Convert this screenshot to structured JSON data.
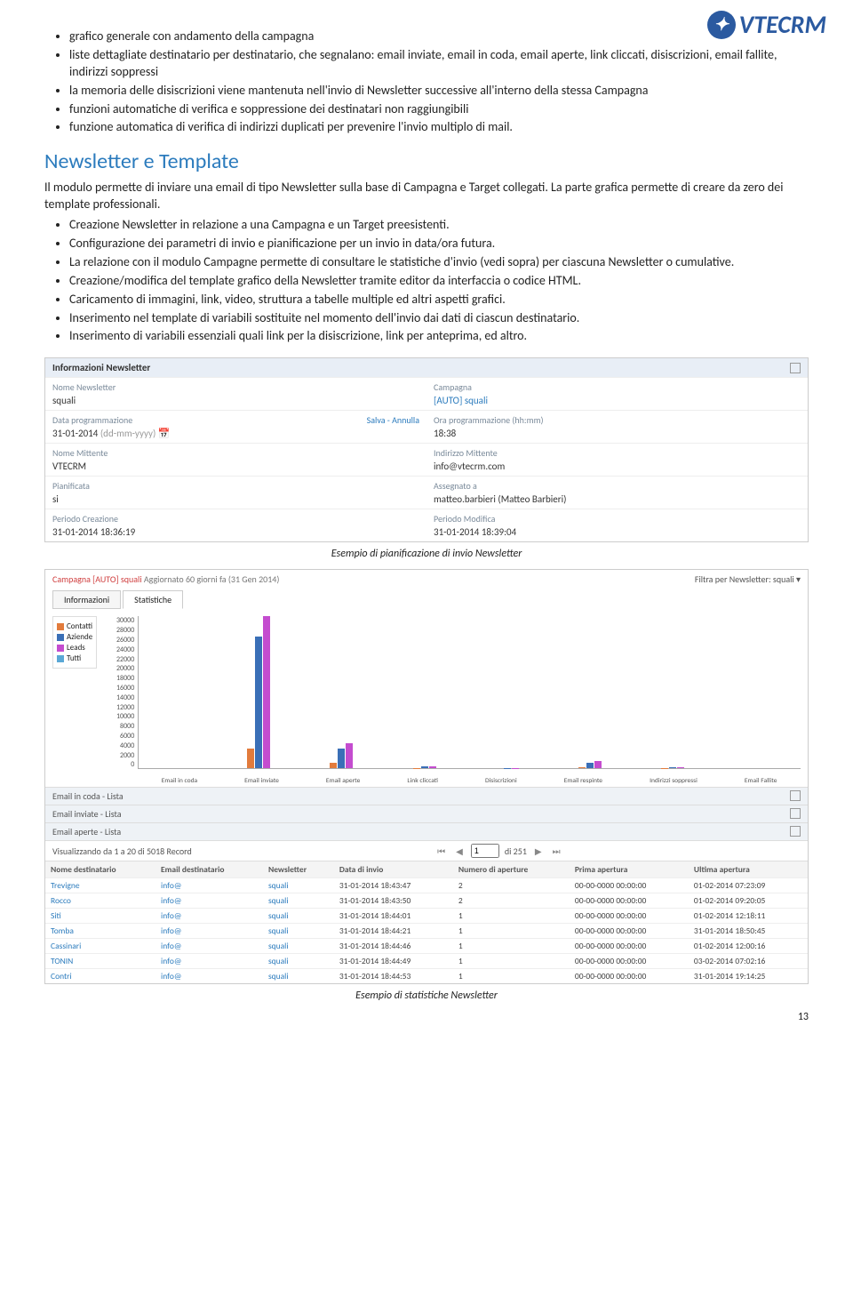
{
  "logo": "VTECRM",
  "top_bullets": [
    "grafico generale con andamento della campagna",
    "liste dettagliate destinatario per destinatario, che segnalano: email inviate, email in coda, email aperte, link cliccati, disiscrizioni, email fallite, indirizzi soppressi",
    "la memoria delle disiscrizioni viene mantenuta nell'invio di Newsletter successive all'interno della stessa Campagna",
    "funzioni automatiche di verifica e soppressione dei destinatari non raggiungibili",
    "funzione automatica di verifica di indirizzi duplicati per prevenire l'invio multiplo di mail."
  ],
  "sec_title": "Newsletter e Template",
  "sec_intro": "Il modulo permette di inviare una email di tipo Newsletter sulla base di Campagna e Target collegati. La parte grafica permette di creare da zero dei template professionali.",
  "sec_bullets": [
    "Creazione Newsletter in relazione a una Campagna e un Target preesistenti.",
    "Configurazione dei parametri di invio e pianificazione per un invio in data/ora futura.",
    "La relazione con il modulo Campagne permette di consultare le statistiche d'invio (vedi sopra) per ciascuna Newsletter o cumulative.",
    "Creazione/modifica del template grafico della Newsletter tramite editor da interfaccia o codice HTML.",
    "Caricamento di immagini, link, video, struttura a tabelle multiple ed altri aspetti grafici.",
    "Inserimento nel template di variabili sostituite nel momento dell'invio dai dati di ciascun destinatario.",
    "Inserimento di variabili essenziali quali link per la disiscrizione, link per anteprima, ed altro."
  ],
  "form": {
    "header": "Informazioni Newsletter",
    "rows": [
      {
        "l": "Nome Newsletter",
        "v": "squali",
        "r": "Campagna",
        "rv": "[AUTO] squali",
        "rlink": true
      },
      {
        "l": "Data programmazione",
        "v": "31-01-2014",
        "hint": "(dd-mm-yyyy)",
        "act": "Salva - Annulla",
        "r": "Ora programmazione (hh:mm)",
        "rv": "18:38"
      },
      {
        "l": "Nome Mittente",
        "v": "VTECRM",
        "r": "Indirizzo Mittente",
        "rv": "info@vtecrm.com"
      },
      {
        "l": "Pianificata",
        "v": "si",
        "r": "Assegnato a",
        "rv": "matteo.barbieri (Matteo Barbieri)"
      },
      {
        "l": "Periodo Creazione",
        "v": "31-01-2014 18:36:19",
        "r": "Periodo Modifica",
        "rv": "31-01-2014 18:39:04"
      }
    ]
  },
  "caption1": "Esempio di pianificazione di invio Newsletter",
  "stats": {
    "title_pre": "Campagna [AUTO] squali",
    "title_post": " Aggiornato 60 giorni fa (31 Gen 2014)",
    "filter": "Filtra per Newsletter: squali ▾",
    "tabs": [
      "Informazioni",
      "Statistiche"
    ],
    "legend": [
      {
        "label": "Contatti",
        "color": "#e27b3c"
      },
      {
        "label": "Aziende",
        "color": "#3a6fb7"
      },
      {
        "label": "Leads",
        "color": "#c44ccf"
      },
      {
        "label": "Tutti",
        "color": "#5aa8d6"
      }
    ],
    "lists": [
      "Email in coda - Lista",
      "Email inviate - Lista",
      "Email aperte - Lista"
    ],
    "recnav": {
      "text": "Visualizzando da 1 a 20 di 5018 Record",
      "page": "1",
      "total": "di 251"
    },
    "cols": [
      "Nome destinatario",
      "Email destinatario",
      "Newsletter",
      "Data di invio",
      "Numero di aperture",
      "Prima apertura",
      "Ultima apertura"
    ],
    "rows": [
      [
        "Trevigne",
        "info@",
        "squali",
        "31-01-2014 18:43:47",
        "2",
        "00-00-0000 00:00:00",
        "01-02-2014 07:23:09"
      ],
      [
        "Rocco",
        "info@",
        "squali",
        "31-01-2014 18:43:50",
        "2",
        "00-00-0000 00:00:00",
        "01-02-2014 09:20:05"
      ],
      [
        "Siti",
        "info@",
        "squali",
        "31-01-2014 18:44:01",
        "1",
        "00-00-0000 00:00:00",
        "01-02-2014 12:18:11"
      ],
      [
        "Tomba",
        "info@",
        "squali",
        "31-01-2014 18:44:21",
        "1",
        "00-00-0000 00:00:00",
        "31-01-2014 18:50:45"
      ],
      [
        "Cassinari",
        "info@",
        "squali",
        "31-01-2014 18:44:46",
        "1",
        "00-00-0000 00:00:00",
        "01-02-2014 12:00:16"
      ],
      [
        "TONIN",
        "info@",
        "squali",
        "31-01-2014 18:44:49",
        "1",
        "00-00-0000 00:00:00",
        "03-02-2014 07:02:16"
      ],
      [
        "Contri",
        "info@",
        "squali",
        "31-01-2014 18:44:53",
        "1",
        "00-00-0000 00:00:00",
        "31-01-2014 19:14:25"
      ]
    ]
  },
  "chart_data": {
    "type": "bar",
    "ylim": [
      0,
      30000
    ],
    "yticks": [
      30000,
      28000,
      26000,
      24000,
      22000,
      20000,
      18000,
      16000,
      14000,
      12000,
      10000,
      8000,
      6000,
      4000,
      2000,
      0
    ],
    "categories": [
      "Email in coda",
      "Email inviate",
      "Email aperte",
      "Link cliccati",
      "Disiscrizioni",
      "Email respinte",
      "Indirizzi soppressi",
      "Email Fallite"
    ],
    "series": [
      {
        "name": "Contatti",
        "color": "#e27b3c",
        "values": [
          0,
          4000,
          1200,
          100,
          0,
          300,
          50,
          0
        ]
      },
      {
        "name": "Aziende",
        "color": "#3a6fb7",
        "values": [
          0,
          26000,
          4000,
          400,
          100,
          1200,
          200,
          0
        ]
      },
      {
        "name": "Leads",
        "color": "#c44ccf",
        "values": [
          0,
          30000,
          5000,
          500,
          100,
          1500,
          250,
          0
        ]
      },
      {
        "name": "Tutti",
        "color": "#5aa8d6",
        "values": [
          0,
          0,
          0,
          0,
          0,
          0,
          0,
          0
        ]
      }
    ]
  },
  "caption2": "Esempio di statistiche Newsletter",
  "pagenum": "13"
}
